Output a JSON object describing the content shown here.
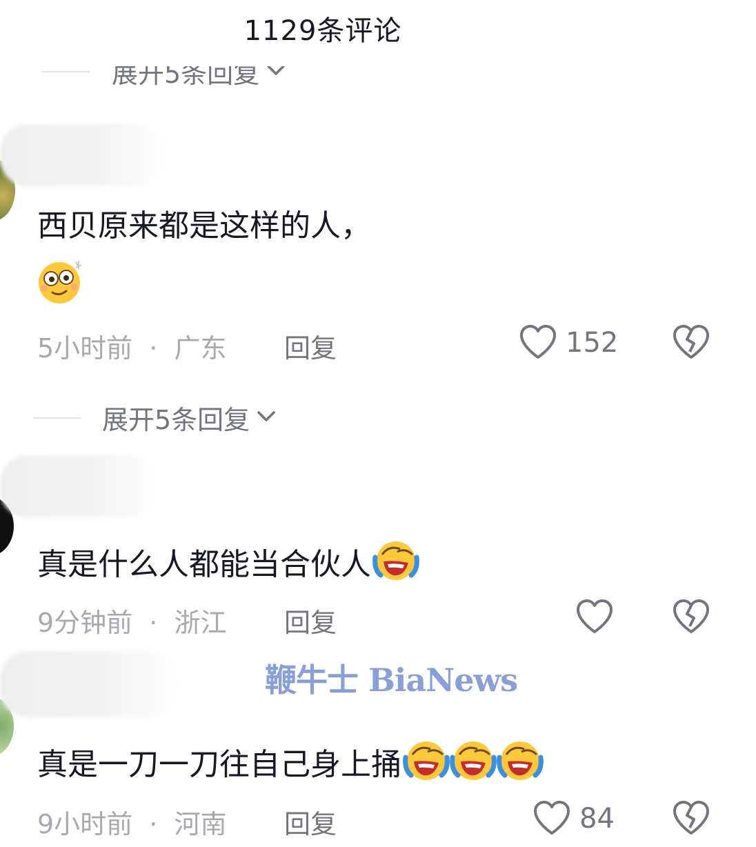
{
  "header": {
    "title": "1129条评论"
  },
  "top_partial_expand": {
    "label": "展开5条回复"
  },
  "comments": [
    {
      "text": "西贝原来都是这样的人，",
      "emojis": [
        "dizzy-face-emoji"
      ],
      "time": "5小时前",
      "location": "广东",
      "reply_label": "回复",
      "likes": "152",
      "expand_label": "展开5条回复"
    },
    {
      "text": "真是什么人都能当合伙人",
      "emojis": [
        "crying-laughing-emoji"
      ],
      "time": "9分钟前",
      "location": "浙江",
      "reply_label": "回复",
      "likes": ""
    },
    {
      "text": "真是一刀一刀往自己身上捅",
      "emojis": [
        "crying-laughing-emoji",
        "crying-laughing-emoji",
        "crying-laughing-emoji"
      ],
      "time": "9小时前",
      "location": "河南",
      "reply_label": "回复",
      "likes": "84"
    }
  ],
  "separator": "·",
  "watermark": "鞭牛士 BiaNews",
  "colors": {
    "text": "#161823",
    "meta": "#a8a9ae",
    "secondary": "#73757e",
    "watermark": "#8a9fd6"
  }
}
